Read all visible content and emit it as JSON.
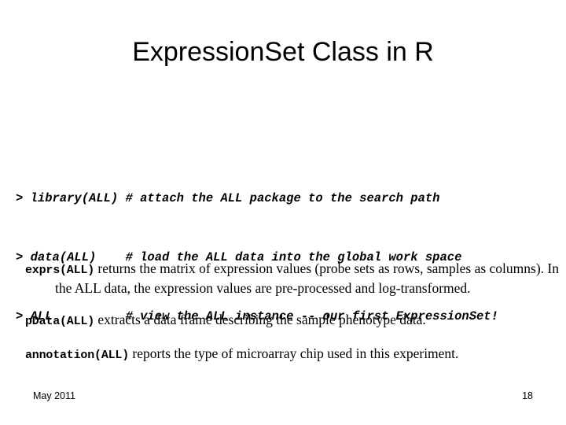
{
  "slide": {
    "title": "ExpressionSet Class in R",
    "background_color": "#ffffff",
    "text_color": "#000000"
  },
  "code_block": {
    "lines": [
      "> library(ALL) # attach the ALL package to the search path",
      "> data(ALL)    # load the ALL data into the global work space",
      "> ALL          # view the ALL instance -- our first ExpressionSet!"
    ],
    "line_1": "> library(ALL) # attach the ALL package to the search path",
    "line_2": "> data(ALL)    # load the ALL data into the global work space",
    "line_3": "> ALL          # view the ALL instance -- our first ExpressionSet!"
  },
  "descriptions": [
    {
      "function": "exprs(ALL)",
      "text": " returns the matrix of expression values (probe sets as rows, samples as columns). In the ALL data, the expression values are pre-processed and log-transformed."
    },
    {
      "function": "pData(ALL)",
      "text": " extracts a data frame describing the sample phenotype data."
    },
    {
      "function": "annotation(ALL)",
      "text": " reports the type of microarray chip used in this experiment."
    }
  ],
  "footer": {
    "date": "May 2011",
    "page_number": "18"
  }
}
